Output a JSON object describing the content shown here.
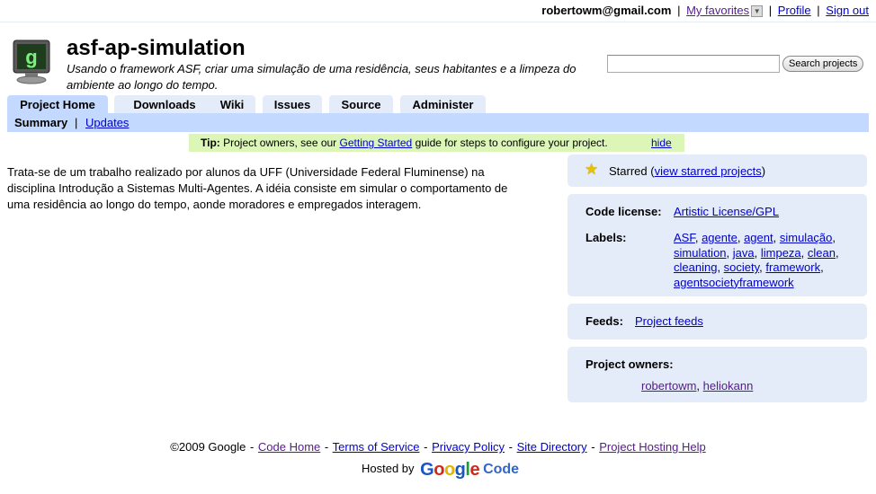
{
  "topbar": {
    "email": "robertowm@gmail.com",
    "favorites": "My favorites",
    "profile": "Profile",
    "signout": "Sign out",
    "sep": "|"
  },
  "project": {
    "name": "asf-ap-simulation",
    "summary": "Usando o framework ASF, criar uma simulação de uma residência, seus habitantes e a limpeza do ambiente ao longo do tempo."
  },
  "search": {
    "value": "",
    "button": "Search projects"
  },
  "tabs": [
    {
      "label": "Project Home"
    },
    {
      "label": "Downloads"
    },
    {
      "label": "Wiki"
    },
    {
      "label": "Issues"
    },
    {
      "label": "Source"
    },
    {
      "label": "Administer"
    }
  ],
  "subnav": {
    "summary": "Summary",
    "bar": "|",
    "updates": "Updates"
  },
  "tip": {
    "prefix": "Tip:",
    "text_before": " Project owners, see our ",
    "link": "Getting Started",
    "text_after": " guide for steps to configure your project.",
    "hide": "hide"
  },
  "description": "Trata-se de um trabalho realizado por alunos da UFF (Universidade Federal Fluminense) na disciplina Introdução a Sistemas Multi-Agentes. A idéia consiste em simular o comportamento de uma residência ao longo do tempo, aonde moradores e empregados interagem.",
  "sidebar": {
    "starred": "Starred (",
    "starred_link": "view starred projects",
    "starred_close": ")",
    "license_label": "Code license:",
    "license": "Artistic License/GPL",
    "labels_label": "Labels:",
    "labels": [
      "ASF",
      "agente",
      "agent",
      "simulação",
      "simulation",
      "java",
      "limpeza",
      "clean",
      "cleaning",
      "society",
      "framework",
      "agentsocietyframework"
    ],
    "feeds_label": "Feeds:",
    "feeds_link": "Project feeds",
    "owners_label": "Project owners:",
    "owners": [
      "robertowm",
      "heliokann"
    ]
  },
  "footer": {
    "copyright": "©2009 Google",
    "links": [
      "Code Home",
      "Terms of Service",
      "Privacy Policy",
      "Site Directory",
      "Project Hosting Help"
    ],
    "dash": "-",
    "hosted_by": "Hosted by",
    "logo_letters": [
      "G",
      "o",
      "o",
      "g",
      "l",
      "e"
    ],
    "logo_colors": [
      "#1a55c8",
      "#cc2b1b",
      "#e2b300",
      "#1a55c8",
      "#1f9c35",
      "#cc2b1b"
    ],
    "logo_code": "Code"
  }
}
